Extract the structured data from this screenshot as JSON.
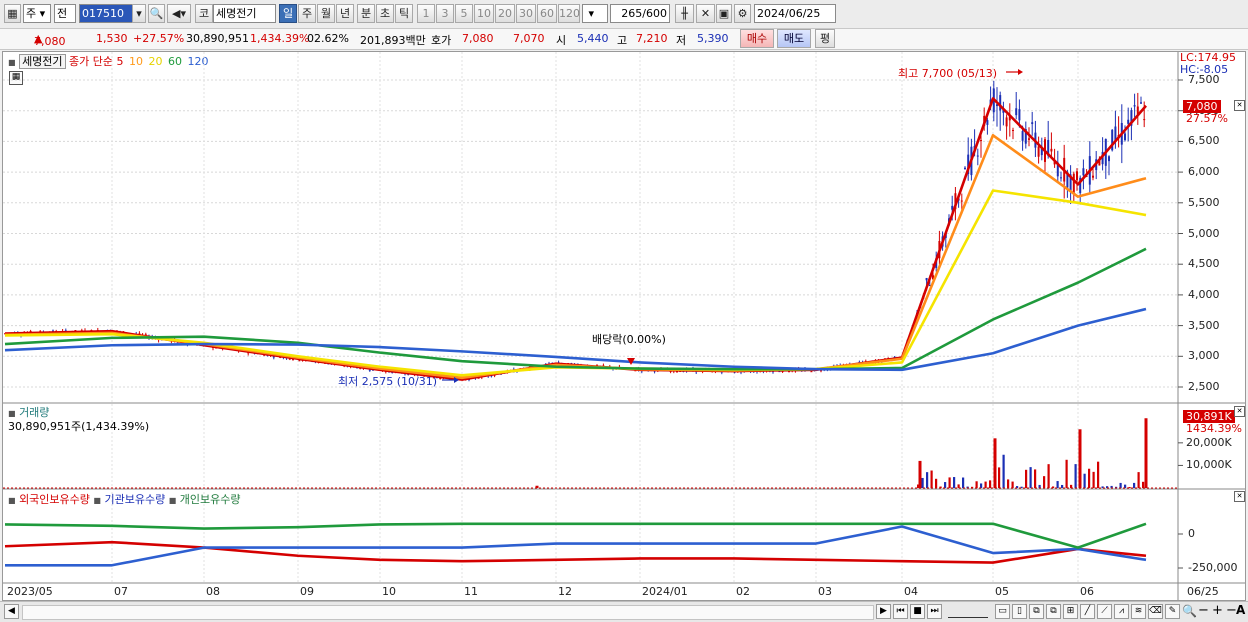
{
  "toolbar": {
    "chart_icon": "chart-icon",
    "period_select": "주",
    "compare_select": "전",
    "code": "017510",
    "name_tag": "코",
    "name": "세명전기",
    "periods": [
      "일",
      "주",
      "월",
      "년",
      "분",
      "초",
      "틱"
    ],
    "active_period": "일",
    "counts": [
      "1",
      "3",
      "5",
      "10",
      "20",
      "30",
      "60",
      "120"
    ],
    "range": "265",
    "range_max": "/600",
    "date": "2024/06/25"
  },
  "quote": {
    "price": "7,080",
    "change": "1,530",
    "change_pct": "+27.57%",
    "volume": "30,890,951",
    "volume_pct": "1,434.39%",
    "turnover": "02.62%",
    "amount": "201,893백만",
    "bid_label": "호가",
    "ask": "7,080",
    "bid": "7,070",
    "open_label": "시",
    "open": "5,440",
    "high_label": "고",
    "high": "7,210",
    "low_label": "저",
    "low": "5,390",
    "buy": "매수",
    "sell": "매도",
    "eval": "평"
  },
  "price_panel": {
    "name_label": "세명전기",
    "ma_label": "종가 단순 5",
    "ma_periods": [
      "10",
      "20",
      "60",
      "120"
    ],
    "lc": "LC:174.95",
    "hc": "HC:-8.05",
    "current": "7,080",
    "current_pct": "27.57%",
    "max_label": "최고 7,700 (05/13)",
    "min_label": "최저 2,575 (10/31)",
    "dividend_label": "배당락(0.00%)"
  },
  "volume_panel": {
    "title": "거래량",
    "info": "30,890,951주(1,434.39%)",
    "current": "30,891K",
    "current_pct": "1434.39%"
  },
  "holding_panel": {
    "foreign": "외국인보유수량",
    "inst": "기관보유수량",
    "indiv": "개인보유수량"
  },
  "colors": {
    "up": "#d40000",
    "down": "#1b2fb5",
    "ma5": "#d40000",
    "ma10": "#ff8c1a",
    "ma20": "#f5e400",
    "ma60": "#1f9a3c",
    "ma120": "#2d5fd0"
  },
  "chart_data": [
    {
      "type": "line",
      "title": "세명전기",
      "x": [
        "2023/05",
        "07",
        "08",
        "09",
        "10",
        "11",
        "12",
        "2024/01",
        "02",
        "03",
        "04",
        "05",
        "06",
        "06/25"
      ],
      "ylim": [
        2500,
        7500
      ],
      "yticks": [
        "7,500",
        "7,000",
        "6,500",
        "6,000",
        "5,500",
        "5,000",
        "4,500",
        "4,000",
        "3,500",
        "3,000",
        "2,500"
      ],
      "series": [
        {
          "name": "5",
          "values": [
            3370,
            3410,
            3180,
            2960,
            2780,
            2620,
            2880,
            2780,
            2760,
            2780,
            2980,
            7200,
            5800,
            7080
          ]
        },
        {
          "name": "10",
          "values": [
            3350,
            3380,
            3200,
            2980,
            2800,
            2650,
            2860,
            2790,
            2770,
            2790,
            2960,
            6600,
            5600,
            5900
          ]
        },
        {
          "name": "20",
          "values": [
            3340,
            3360,
            3220,
            3000,
            2830,
            2690,
            2820,
            2800,
            2780,
            2790,
            2900,
            5700,
            5500,
            5300
          ]
        },
        {
          "name": "60",
          "values": [
            3200,
            3300,
            3320,
            3220,
            3060,
            2920,
            2830,
            2800,
            2790,
            2790,
            2810,
            3600,
            4200,
            4750
          ]
        },
        {
          "name": "120",
          "values": [
            3100,
            3180,
            3200,
            3190,
            3150,
            3080,
            2990,
            2900,
            2830,
            2790,
            2780,
            3050,
            3500,
            3770
          ]
        }
      ]
    },
    {
      "type": "bar",
      "title": "거래량",
      "yticks": [
        "20,000K",
        "10,000K"
      ],
      "x": [
        "11",
        "04",
        "05",
        "06",
        "06/25"
      ],
      "values": [
        1000,
        12000,
        22000,
        26000,
        30891
      ]
    },
    {
      "type": "line",
      "yticks": [
        "0",
        "-250,000"
      ],
      "series": [
        {
          "name": "외국인보유수량",
          "values": [
            -90000,
            -60000,
            -100000,
            -160000,
            -190000,
            -200000,
            -190000,
            -180000,
            -180000,
            -190000,
            -200000,
            -210000,
            -110000,
            -160000
          ]
        },
        {
          "name": "기관보유수량",
          "values": [
            -230000,
            -230000,
            -100000,
            -100000,
            -100000,
            -100000,
            -70000,
            -70000,
            -70000,
            -70000,
            55000,
            -140000,
            -110000,
            -190000
          ]
        },
        {
          "name": "개인보유수량",
          "values": [
            70000,
            60000,
            40000,
            50000,
            70000,
            75000,
            75000,
            75000,
            75000,
            75000,
            75000,
            75000,
            -100000,
            75000
          ]
        }
      ]
    }
  ]
}
